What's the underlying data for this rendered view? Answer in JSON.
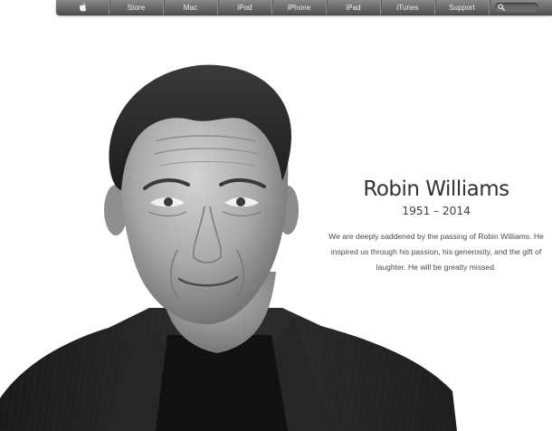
{
  "nav": {
    "apple_icon": "apple-logo-icon",
    "items": [
      "Store",
      "Mac",
      "iPod",
      "iPhone",
      "iPad",
      "iTunes",
      "Support"
    ],
    "search_icon": "magnifier-icon"
  },
  "tribute": {
    "name": "Robin Williams",
    "years": "1951 – 2014",
    "message": "We are deeply saddened by the passing of Robin Williams. He inspired us through his passion, his generosity, and the gift of laughter. He will be greatly missed."
  }
}
